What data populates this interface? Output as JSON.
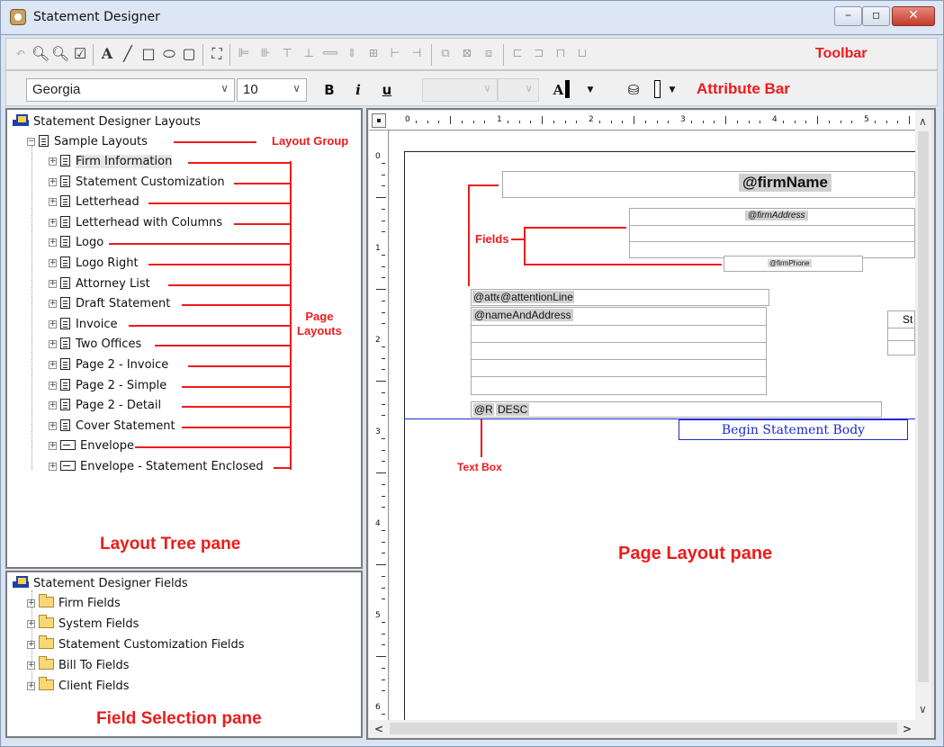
{
  "window": {
    "title": "Statement Designer"
  },
  "toolbar": {
    "annotation": "Toolbar",
    "icons": [
      "undo-icon",
      "zoom-in-icon",
      "zoom-out-icon",
      "properties-icon",
      "text-icon",
      "line-icon",
      "rectangle-icon",
      "ellipse-icon",
      "rounded-rect-icon",
      "image-icon",
      "align-left-icon",
      "align-right-icon",
      "align-top-icon",
      "align-bottom-icon",
      "same-width-icon",
      "same-height-icon",
      "same-size-icon",
      "space-horizontal-icon",
      "space-vertical-icon",
      "bring-front-icon",
      "group-icon",
      "send-back-icon",
      "text-left-icon",
      "text-center-icon",
      "text-right-icon",
      "text-justify-icon"
    ]
  },
  "attribute_bar": {
    "annotation": "Attribute Bar",
    "font": "Georgia",
    "size": "10",
    "bold": "B",
    "italic": "i",
    "underline": "u",
    "font_color_label": "A"
  },
  "layout_tree": {
    "root": "Statement Designer Layouts",
    "group": "Sample Layouts",
    "group_annotation": "Layout Group",
    "page_layouts_annotation": "Page\nLayouts",
    "pane_annotation": "Layout Tree pane",
    "items": [
      {
        "label": "Firm Information",
        "type": "doc",
        "selected": true
      },
      {
        "label": "Statement Customization",
        "type": "doc"
      },
      {
        "label": "Letterhead",
        "type": "doc"
      },
      {
        "label": "Letterhead with Columns",
        "type": "doc"
      },
      {
        "label": "Logo",
        "type": "doc"
      },
      {
        "label": "Logo Right",
        "type": "doc"
      },
      {
        "label": "Attorney List",
        "type": "doc"
      },
      {
        "label": "Draft Statement",
        "type": "doc"
      },
      {
        "label": "Invoice",
        "type": "doc"
      },
      {
        "label": "Two Offices",
        "type": "doc"
      },
      {
        "label": "Page 2 - Invoice",
        "type": "doc"
      },
      {
        "label": "Page 2 - Simple",
        "type": "doc"
      },
      {
        "label": "Page 2 - Detail",
        "type": "doc"
      },
      {
        "label": "Cover Statement",
        "type": "doc"
      },
      {
        "label": "Envelope",
        "type": "envelope"
      },
      {
        "label": "Envelope - Statement Enclosed",
        "type": "envelope"
      }
    ]
  },
  "field_selection": {
    "root": "Statement Designer Fields",
    "pane_annotation": "Field Selection pane",
    "items": [
      "Firm Fields",
      "System Fields",
      "Statement Customization Fields",
      "Bill To Fields",
      "Client Fields"
    ]
  },
  "page_layout": {
    "pane_annotation": "Page Layout pane",
    "fields_annotation": "Fields",
    "textbox_annotation": "Text Box",
    "ruler_h": [
      "0",
      "1",
      "2",
      "3",
      "4",
      "5"
    ],
    "ruler_v": [
      "0",
      "1",
      "2",
      "3",
      "4",
      "5",
      "6"
    ],
    "firm_name": "@firmName",
    "firm_address": "@firmAddress",
    "firm_phone": "@firmPhone",
    "attention_prefix": "@atte",
    "attention_line": "@attentionLine",
    "name_and_address": "@nameAndAddress",
    "st_box": "St",
    "desc_prefix": "@R",
    "desc": "DESC",
    "body_label": "Begin Statement Body"
  }
}
